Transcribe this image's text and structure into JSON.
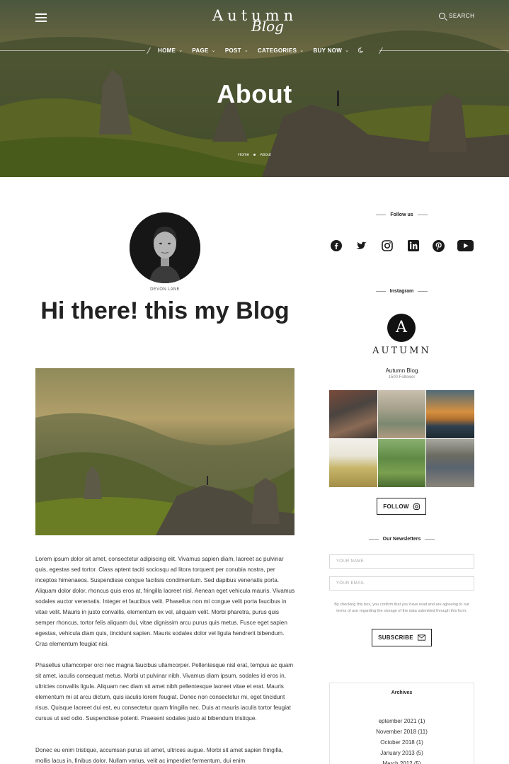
{
  "header": {
    "logo_line1": "Autumn",
    "logo_line2": "Blog",
    "search_label": "SEARCH",
    "nav": [
      {
        "label": "HOME"
      },
      {
        "label": "PAGE"
      },
      {
        "label": "POST"
      },
      {
        "label": "CATEGORIES"
      },
      {
        "label": "BUY NOW"
      }
    ]
  },
  "hero": {
    "title": "About",
    "breadcrumb": [
      "Home",
      "About"
    ]
  },
  "author": {
    "name": "DEVON LANE",
    "headline": "Hi there! this my Blog"
  },
  "article": {
    "paragraphs": [
      "Lorem ipsum dolor sit amet, consectetur adipiscing elit. Vivamus sapien diam, laoreet ac pulvinar quis, egestas sed tortor. Class aptent taciti sociosqu ad litora torquent per conubia nostra, per inceptos himenaeos. Suspendisse congue facilisis condimentum. Sed dapibus venenatis porta. Aliquam dolor dolor, rhoncus quis eros at, fringilla laoreet nisl. Aenean eget vehicula mauris. Vivamus sodales auctor venenatis. Integer et faucibus velit. Phasellus non mi congue velit porta faucibus in vitae velit. Mauris in justo convallis, elementum ex vel, aliquam velit. Morbi pharetra, purus quis semper rhoncus, tortor felis aliquam dui, vitae dignissim arcu purus quis metus. Fusce eget sapien egestas, vehicula diam quis, tincidunt sapien. Mauris sodales dolor vel ligula hendrerit bibendum. Cras elementum feugiat nisi.",
      "Phasellus ullamcorper orci nec magna faucibus ullamcorper. Pellentesque nisl erat, tempus ac quam sit amet, iaculis consequat metus. Morbi ut pulvinar nibh. Vivamus diam ipsum, sodales id eros in, ultricies convallis ligula. Aliquam nec diam sit amet nibh pellentesque laoreet vitae et erat. Mauris elementum mi at arcu dictum, quis iaculis lorem feugiat. Donec non consectetur mi, eget tincidunt risus. Quisque laoreet dui est, eu consectetur quam fringilla nec. Duis at mauris iaculis tortor feugiat cursus ut sed odio. Suspendisse potenti. Praesent sodales justo at bibendum tristique.",
      "Donec eu enim tristique, accumsan purus sit amet, ultrices augue. Morbi sit amet sapien fringilla, mollis lacus in, finibus dolor. Nullam varius, velit ac imperdiet fermentum, dui enim"
    ]
  },
  "sidebar": {
    "follow_heading": "Follow us",
    "socials": [
      "facebook-icon",
      "twitter-icon",
      "instagram-icon",
      "linkedin-icon",
      "pinterest-icon",
      "youtube-icon"
    ],
    "instagram_heading": "Instagram",
    "instagram_logo_letter": "A",
    "instagram_wordmark": "AUTUMN",
    "instagram_account": "Autumn Blog",
    "instagram_followers": "1500 Follower",
    "follow_button": "FOLLOW",
    "newsletter_heading": "Our Newsletters",
    "name_placeholder": "YOUR NAME",
    "email_placeholder": "YOUR EMAIL",
    "consent_text": "By checking this box, you confirm that you have read and are agreeing to our terms of use regarding the storage of the data submitted through this form.",
    "subscribe_button": "SUBSCRIBE",
    "archives_heading": "Archives",
    "archives": [
      "eptember 2021 (1)",
      "November 2018 (11)",
      "October 2018 (1)",
      "January 2013 (5)",
      "March 2012 (5)"
    ]
  },
  "colors": {
    "text": "#222222",
    "hero_overlay": "#000000",
    "border": "#d8d8d8"
  }
}
